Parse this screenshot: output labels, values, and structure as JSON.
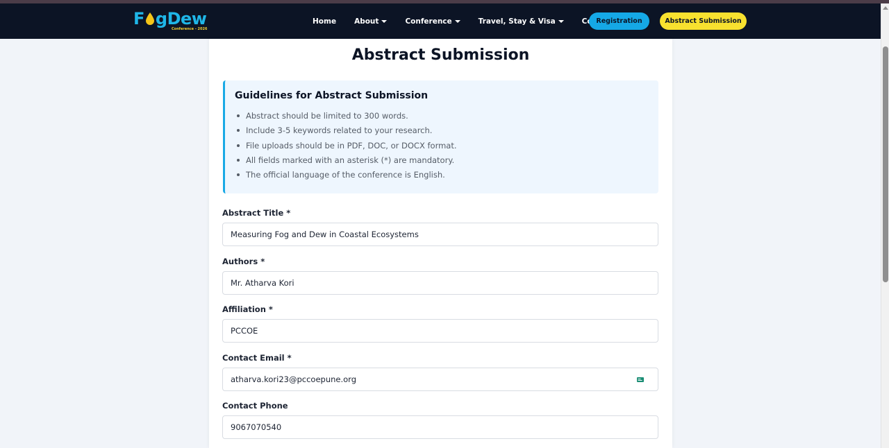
{
  "brand": {
    "name_part1": "F",
    "name_part2": "g",
    "name_part3": "Dew",
    "subtitle": "Conference - 2026",
    "colors": {
      "primary": "#1fb6e8",
      "accent": "#f5d033",
      "nav_bg": "#0c1425"
    }
  },
  "nav": {
    "items": [
      {
        "label": "Home",
        "has_dropdown": false
      },
      {
        "label": "About",
        "has_dropdown": true
      },
      {
        "label": "Conference",
        "has_dropdown": true
      },
      {
        "label": "Travel, Stay & Visa",
        "has_dropdown": true
      },
      {
        "label": "Contact",
        "has_dropdown": false
      }
    ],
    "registration_label": "Registration",
    "abstract_label": "Abstract Submission"
  },
  "page": {
    "title": "Abstract Submission"
  },
  "guidelines": {
    "title": "Guidelines for Abstract Submission",
    "items": [
      "Abstract should be limited to 300 words.",
      "Include 3-5 keywords related to your research.",
      "File uploads should be in PDF, DOC, or DOCX format.",
      "All fields marked with an asterisk (*) are mandatory.",
      "The official language of the conference is English."
    ]
  },
  "form": {
    "abstract_title": {
      "label": "Abstract Title *",
      "value": "Measuring Fog and Dew in Coastal Ecosystems"
    },
    "authors": {
      "label": "Authors *",
      "value": "Mr. Atharva Kori"
    },
    "affiliation": {
      "label": "Affiliation *",
      "value": "PCCOE"
    },
    "email": {
      "label": "Contact Email *",
      "value": "atharva.kori23@pccoepune.org",
      "icon": "autofill-card-icon"
    },
    "phone": {
      "label": "Contact Phone",
      "value": "9067070540"
    }
  }
}
